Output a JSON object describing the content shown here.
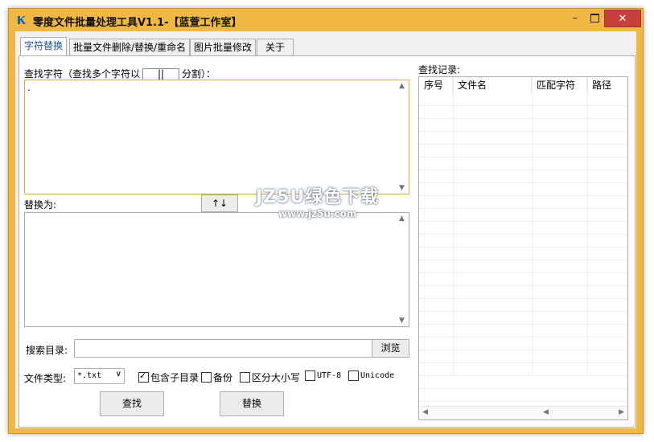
{
  "window": {
    "title": "零度文件批量处理工具V1.1-【蓝萱工作室】",
    "accent_color": "#efb842",
    "close_color": "#c8403a"
  },
  "titlebar_controls": {
    "minimize": "–",
    "close": "✕"
  },
  "tabs": [
    {
      "label": "字符替换",
      "active": true
    },
    {
      "label": "批量文件删除/替换/重命名",
      "active": false
    },
    {
      "label": "图片批量修改",
      "active": false
    },
    {
      "label": "关于",
      "active": false
    }
  ],
  "find": {
    "label_prefix": "查找字符（查找多个字符以",
    "separator": "||",
    "label_suffix": "分割）：",
    "value": "."
  },
  "replace": {
    "label": "替换为:",
    "swap_button": "↑↓",
    "value": ""
  },
  "search_dir": {
    "label": "搜索目录:",
    "value": "",
    "browse_button": "浏览"
  },
  "file_type": {
    "label": "文件类型:",
    "selected": "*.txt"
  },
  "options": [
    {
      "label": "包含子目录",
      "checked": true
    },
    {
      "label": "备份",
      "checked": false
    },
    {
      "label": "区分大小写",
      "checked": false
    },
    {
      "label": "UTF-8",
      "checked": false
    },
    {
      "label": "Unicode",
      "checked": false
    }
  ],
  "actions": {
    "find_button": "查找",
    "replace_button": "替换"
  },
  "results": {
    "label": "查找记录:",
    "columns": [
      "序号",
      "文件名",
      "匹配字符",
      "路径"
    ],
    "rows": []
  },
  "watermark": {
    "line1": "JZ5U绿色下载",
    "line2": "www.jz5u.com"
  }
}
